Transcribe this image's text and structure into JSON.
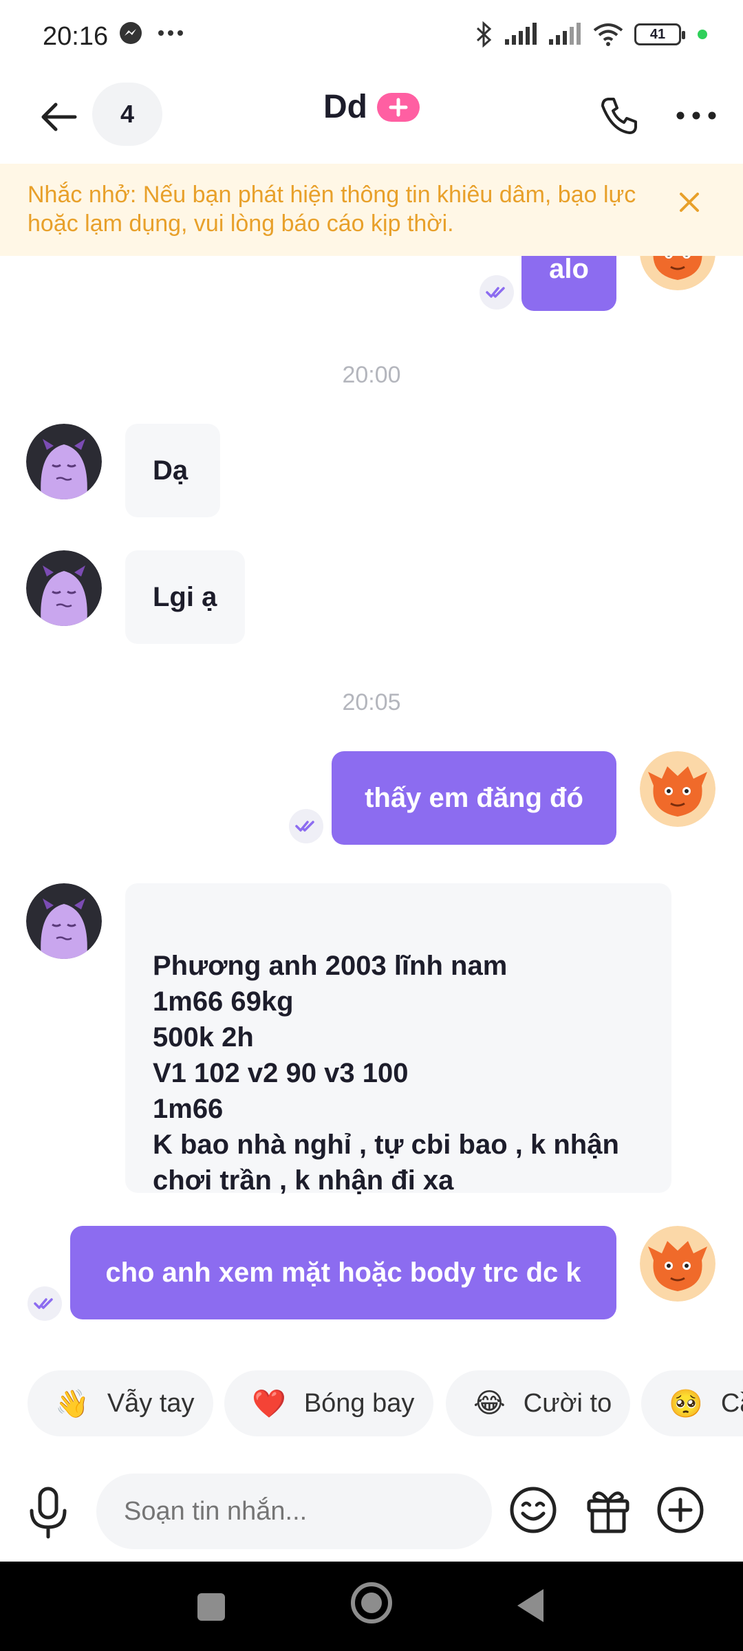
{
  "status_bar": {
    "time": "20:16",
    "battery": "41"
  },
  "header": {
    "count": "4",
    "title": "Dd"
  },
  "banner": {
    "text": "Nhắc nhở: Nếu bạn phát hiện thông tin khiêu dâm, bạo lực hoặc lạm dụng, vui lòng báo cáo kịp thời."
  },
  "messages": [
    {
      "from": "me",
      "text": "alo"
    },
    {
      "type": "timestamp",
      "text": "20:00"
    },
    {
      "from": "them",
      "text": "Dạ"
    },
    {
      "from": "them",
      "text": "Lgi ạ"
    },
    {
      "type": "timestamp",
      "text": "20:05"
    },
    {
      "from": "me",
      "text": "thấy em đăng đó"
    },
    {
      "from": "them",
      "text": "Phương anh 2003 lĩnh nam\n1m66 69kg\n500k 2h\nV1 102 v2 90 v3 100\n1m66\nK bao nhà nghỉ , tự cbi bao , k nhận chơi trần , k nhận đi xa"
    },
    {
      "from": "me",
      "text": "cho anh xem mặt hoặc body trc dc k"
    }
  ],
  "quick_reactions": [
    {
      "emoji": "👋",
      "label": "Vẫy tay"
    },
    {
      "emoji": "❤️",
      "label": "Bóng bay"
    },
    {
      "emoji": "😂",
      "label": "Cười to"
    },
    {
      "emoji": "🥺",
      "label": "Cầ"
    }
  ],
  "composer": {
    "placeholder": "Soạn tin nhắn..."
  },
  "colors": {
    "accent": "#8c6cf0",
    "badge": "#ff5fa2",
    "banner_bg": "#fff7e6",
    "banner_text": "#e8a02a"
  }
}
